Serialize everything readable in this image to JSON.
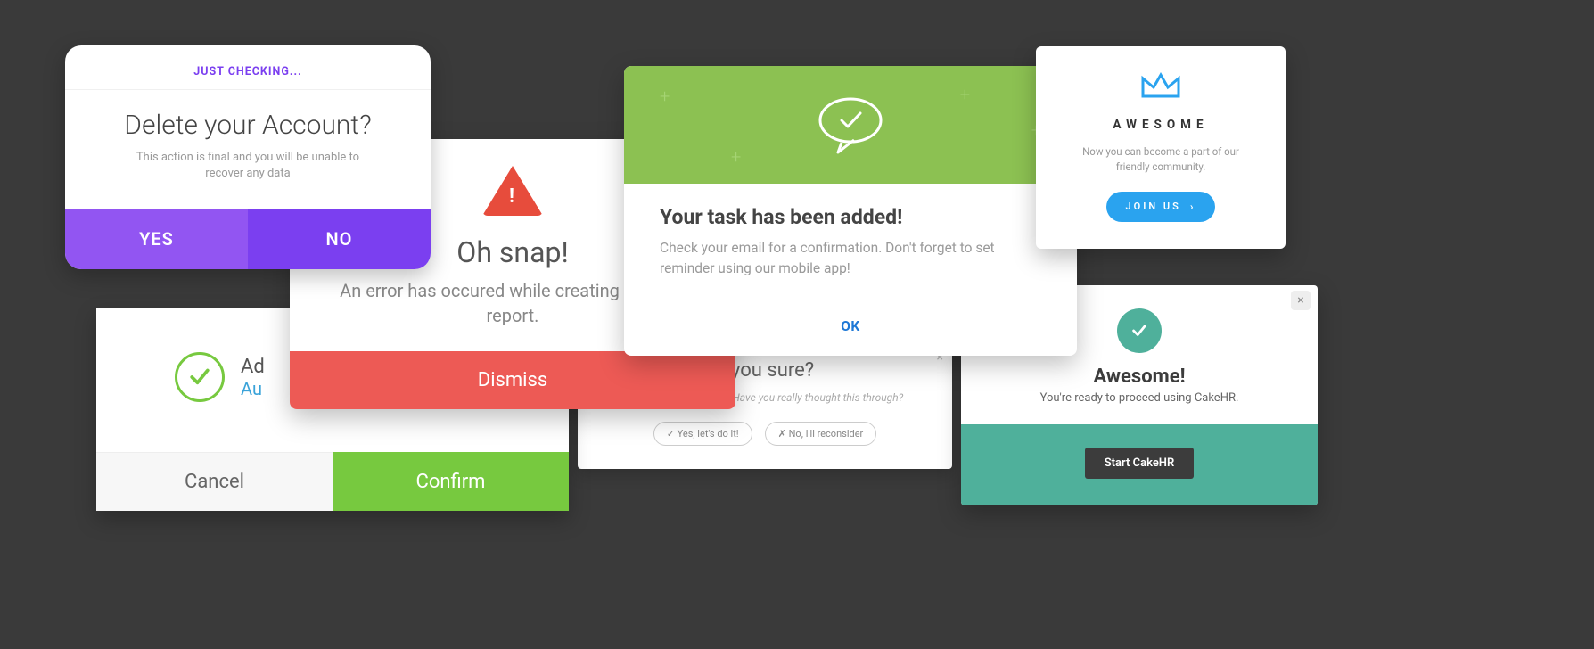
{
  "deleteCard": {
    "tag": "JUST CHECKING...",
    "title": "Delete your Account?",
    "subtitle": "This action is final and you will be unable to recover any data",
    "yes": "YES",
    "no": "NO"
  },
  "errorCard": {
    "exclaim": "!",
    "title": "Oh snap!",
    "body": "An error has occured while creating an error report.",
    "dismiss": "Dismiss"
  },
  "confirmCard": {
    "line1": "Ad",
    "line2": "Au",
    "cancel": "Cancel",
    "confirm": "Confirm"
  },
  "sureCard": {
    "title": "e you sure?",
    "body": "at's some serious shit. Have you really thought this through?",
    "yes": "✓ Yes, let's do it!",
    "no": "✗ No, I'll reconsider"
  },
  "taskCard": {
    "title": "Your task has been added!",
    "body": "Check your email for a confirmation. Don't forget to set reminder using our mobile app!",
    "ok": "OK"
  },
  "joinCard": {
    "title": "AWESOME",
    "body": "Now you can become a part of our friendly community.",
    "btn": "JOIN US",
    "chev": "›"
  },
  "cakeCard": {
    "close": "×",
    "title": "Awesome!",
    "body": "You're ready to proceed using CakeHR.",
    "btn": "Start CakeHR"
  }
}
